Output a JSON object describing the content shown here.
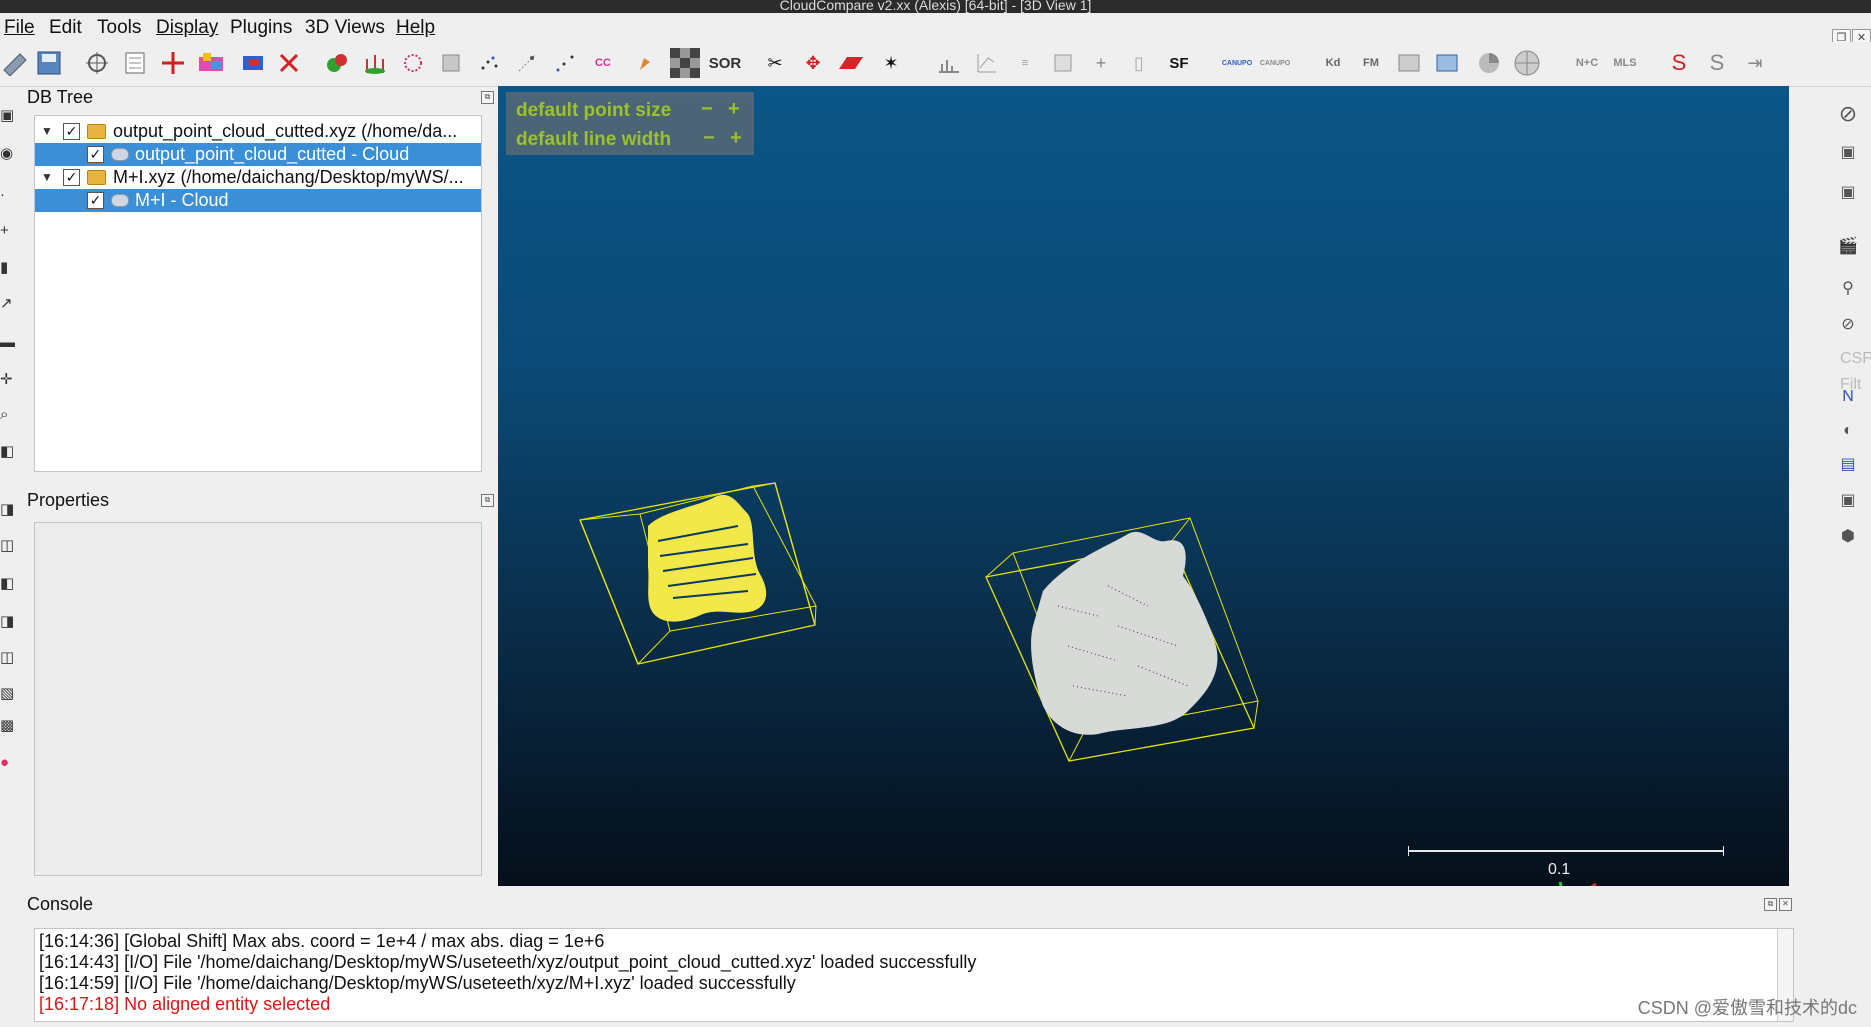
{
  "window": {
    "title": "CloudCompare v2.xx (Alexis) [64-bit] - [3D View 1]"
  },
  "menu": {
    "items": [
      "File",
      "Edit",
      "Tools",
      "Display",
      "Plugins",
      "3D Views",
      "Help"
    ]
  },
  "toolbar": {
    "icons": [
      "open-icon",
      "save-icon",
      "sf-icon",
      "list-icon",
      "cross-icon",
      "colors-icon",
      "exchange-icon",
      "delete-icon",
      "merge-icon",
      "normals-icon",
      "sample-icon",
      "subsample-icon",
      "noise-icon",
      "scatter-icon",
      "grid-icon",
      "cc-icon",
      "paint-icon",
      "checker-icon",
      "sor-icon",
      "scissors-icon",
      "move-icon",
      "plane-icon",
      "pointpick-icon",
      "histogram-icon",
      "stats-icon",
      "minmax-icon",
      "compute-icon",
      "plus-icon",
      "clear-icon",
      "sf-tools-icon",
      "canupo-create-icon",
      "canupo-classify-icon",
      "kd-icon",
      "fm-icon",
      "shp-icon",
      "csv-icon",
      "pie-icon",
      "sphere-icon",
      "n-c-icon",
      "mls-icon",
      "s-icon",
      "s-line-icon",
      "export-icon"
    ],
    "labels": {
      "sor": "SOR",
      "sf": "SF",
      "kd": "Kd",
      "fm": "FM",
      "nc": "N+C",
      "mls": "MLS",
      "cc": "CC",
      "canupo1": "CANUPO",
      "canupo2": "CANUPO"
    }
  },
  "panels": {
    "dbtree": {
      "title": "DB Tree"
    },
    "properties": {
      "title": "Properties"
    },
    "console": {
      "title": "Console"
    }
  },
  "tree": [
    {
      "label": "output_point_cloud_cutted.xyz (/home/da...",
      "type": "file",
      "checked": true,
      "expanded": true
    },
    {
      "label": "output_point_cloud_cutted - Cloud",
      "type": "cloud",
      "checked": true,
      "selected": true
    },
    {
      "label": "M+I.xyz (/home/daichang/Desktop/myWS/...",
      "type": "file",
      "checked": true,
      "expanded": true
    },
    {
      "label": "M+I - Cloud",
      "type": "cloud",
      "checked": true,
      "selected": true
    }
  ],
  "viewport": {
    "hud": {
      "point_size": "default point size",
      "line_width": "default line width",
      "minus": "−",
      "plus": "+"
    },
    "scale_label": "0.1",
    "clouds": [
      {
        "name": "output_point_cloud_cutted - Cloud",
        "color": "#f3e84a"
      },
      {
        "name": "M+I - Cloud",
        "color": "#d8dad8"
      }
    ],
    "bbox_color": "#e8e400"
  },
  "right_panel": {
    "csf_label": "CSF Filt"
  },
  "console_lines": [
    {
      "text": "[16:14:36] [Global Shift] Max abs. coord = 1e+4 / max abs. diag = 1e+6",
      "error": false
    },
    {
      "text": "[16:14:43] [I/O] File '/home/daichang/Desktop/myWS/useteeth/xyz/output_point_cloud_cutted.xyz' loaded successfully",
      "error": false
    },
    {
      "text": "[16:14:59] [I/O] File '/home/daichang/Desktop/myWS/useteeth/xyz/M+I.xyz' loaded successfully",
      "error": false
    },
    {
      "text": "[16:17:18] No aligned entity selected",
      "error": true
    }
  ],
  "watermark": "CSDN @爱傲雪和技术的dc",
  "colors": {
    "selection": "#3a8fd6",
    "hud_text": "#9bc22a",
    "error": "#e01414"
  }
}
